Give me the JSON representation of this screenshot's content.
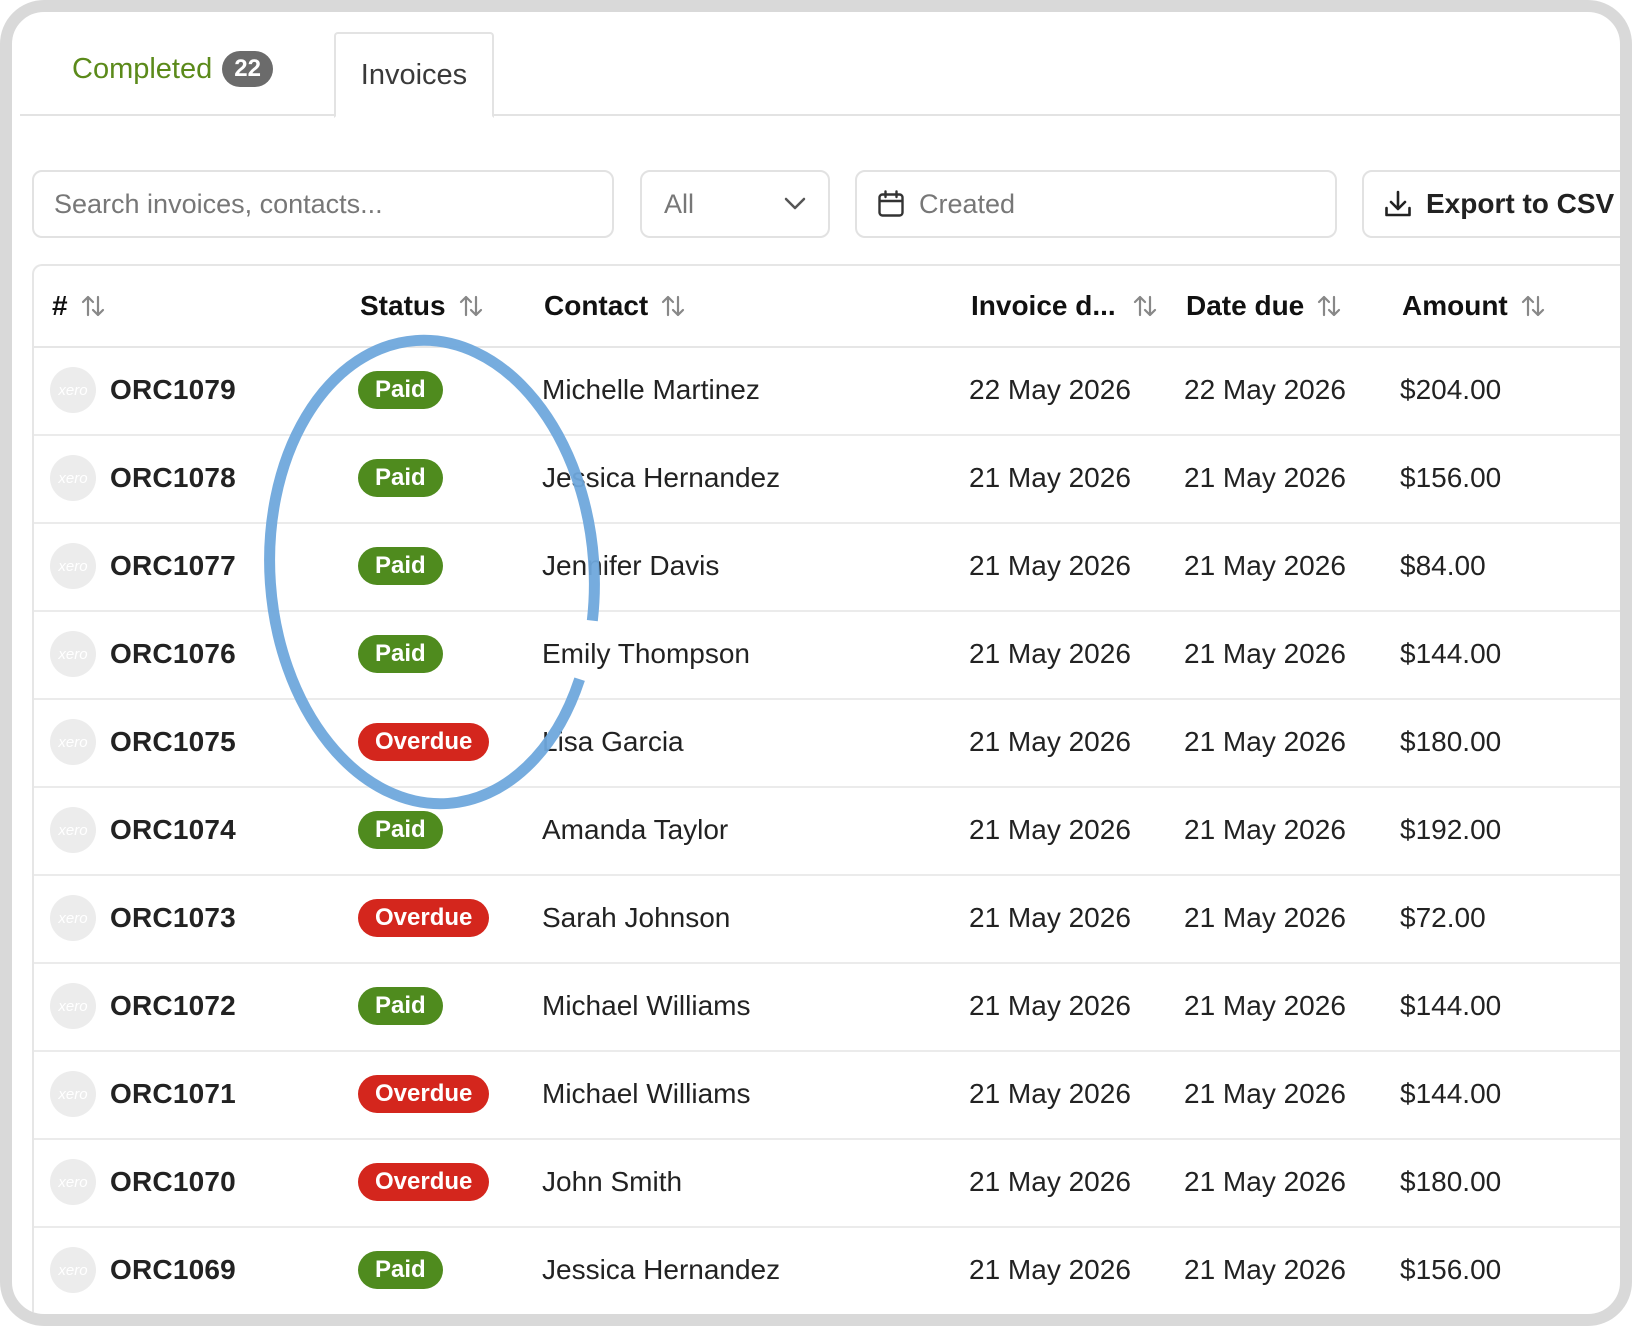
{
  "tabs": {
    "completed_label": "Completed",
    "completed_count": "22",
    "invoices_label": "Invoices"
  },
  "toolbar": {
    "search_placeholder": "Search invoices, contacts...",
    "filter_value": "All",
    "date_placeholder": "Created",
    "export_label": "Export to CSV"
  },
  "table": {
    "headers": {
      "number": "#",
      "status": "Status",
      "contact": "Contact",
      "invoice_date": "Invoice d...",
      "date_due": "Date due",
      "amount": "Amount"
    },
    "avatar_text": "xero",
    "rows": [
      {
        "number": "ORC1079",
        "status": "Paid",
        "contact": "Michelle Martinez",
        "invoice_date": "22 May 2026",
        "date_due": "22 May 2026",
        "amount": "$204.00"
      },
      {
        "number": "ORC1078",
        "status": "Paid",
        "contact": "Jessica Hernandez",
        "invoice_date": "21 May 2026",
        "date_due": "21 May 2026",
        "amount": "$156.00"
      },
      {
        "number": "ORC1077",
        "status": "Paid",
        "contact": "Jennifer Davis",
        "invoice_date": "21 May 2026",
        "date_due": "21 May 2026",
        "amount": "$84.00"
      },
      {
        "number": "ORC1076",
        "status": "Paid",
        "contact": "Emily Thompson",
        "invoice_date": "21 May 2026",
        "date_due": "21 May 2026",
        "amount": "$144.00"
      },
      {
        "number": "ORC1075",
        "status": "Overdue",
        "contact": "Lisa Garcia",
        "invoice_date": "21 May 2026",
        "date_due": "21 May 2026",
        "amount": "$180.00"
      },
      {
        "number": "ORC1074",
        "status": "Paid",
        "contact": "Amanda Taylor",
        "invoice_date": "21 May 2026",
        "date_due": "21 May 2026",
        "amount": "$192.00"
      },
      {
        "number": "ORC1073",
        "status": "Overdue",
        "contact": "Sarah Johnson",
        "invoice_date": "21 May 2026",
        "date_due": "21 May 2026",
        "amount": "$72.00"
      },
      {
        "number": "ORC1072",
        "status": "Paid",
        "contact": "Michael Williams",
        "invoice_date": "21 May 2026",
        "date_due": "21 May 2026",
        "amount": "$144.00"
      },
      {
        "number": "ORC1071",
        "status": "Overdue",
        "contact": "Michael Williams",
        "invoice_date": "21 May 2026",
        "date_due": "21 May 2026",
        "amount": "$144.00"
      },
      {
        "number": "ORC1070",
        "status": "Overdue",
        "contact": "John Smith",
        "invoice_date": "21 May 2026",
        "date_due": "21 May 2026",
        "amount": "$180.00"
      },
      {
        "number": "ORC1069",
        "status": "Paid",
        "contact": "Jessica Hernandez",
        "invoice_date": "21 May 2026",
        "date_due": "21 May 2026",
        "amount": "$156.00"
      }
    ]
  },
  "colors": {
    "paid": "#4f8b1e",
    "overdue": "#d4261d",
    "accent_green": "#5b8a1a",
    "annotation_circle": "#6fa8dc"
  },
  "icons": {
    "sort": "sort-arrows-icon",
    "chevron": "chevron-down-icon",
    "calendar": "calendar-icon",
    "download": "download-icon"
  }
}
